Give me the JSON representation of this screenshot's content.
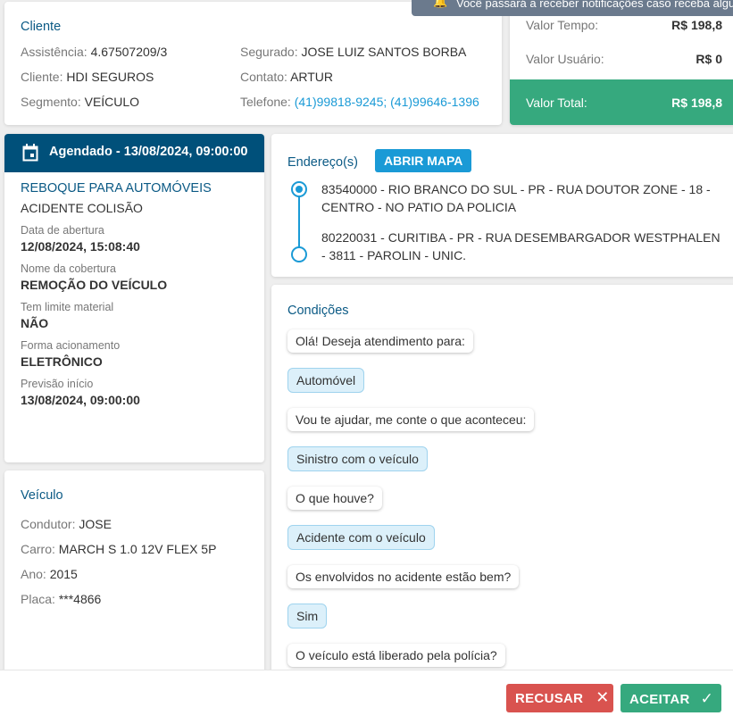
{
  "toast": {
    "text": "Você passará a receber notificações caso receba algu",
    "icon": "bell-icon"
  },
  "cliente": {
    "title": "Cliente",
    "assistencia_label": "Assistência:",
    "assistencia": "4.67507209/3",
    "cliente_label": "Cliente:",
    "cliente": "HDI SEGUROS",
    "segmento_label": "Segmento:",
    "segmento": "VEÍCULO",
    "segurado_label": "Segurado:",
    "segurado": "JOSE LUIZ SANTOS BORBA",
    "contato_label": "Contato:",
    "contato": "ARTUR",
    "telefone_label": "Telefone:",
    "telefone": "(41)99818-9245; (41)99646-1396"
  },
  "valores": {
    "tempo_label": "Valor Tempo:",
    "tempo": "R$ 198,8",
    "usuario_label": "Valor Usuário:",
    "usuario": "R$ 0",
    "total_label": "Valor Total:",
    "total": "R$ 198,8",
    "total_color": "#36a97e"
  },
  "agendado": {
    "header": "Agendado - 13/08/2024, 09:00:00",
    "header_color": "#00507a",
    "servico": "REBOQUE PARA AUTOMÓVEIS",
    "motivo": "ACIDENTE COLISÃO",
    "fields": [
      {
        "label": "Data de abertura",
        "value": "12/08/2024, 15:08:40"
      },
      {
        "label": "Nome da cobertura",
        "value": "REMOÇÃO DO VEÍCULO"
      },
      {
        "label": "Tem limite material",
        "value": "NÃO"
      },
      {
        "label": "Forma acionamento",
        "value": "ELETRÔNICO"
      },
      {
        "label": "Previsão início",
        "value": "13/08/2024, 09:00:00"
      }
    ]
  },
  "veiculo": {
    "title": "Veículo",
    "condutor_label": "Condutor:",
    "condutor": "JOSE",
    "carro_label": "Carro:",
    "carro": "MARCH S 1.0 12V FLEX 5P",
    "ano_label": "Ano:",
    "ano": "2015",
    "placa_label": "Placa:",
    "placa": "***4866"
  },
  "enderecos": {
    "title": "Endereço(s)",
    "map_button": "ABRIR MAPA",
    "items": [
      "83540000 - RIO BRANCO DO SUL - PR - RUA DOUTOR ZONE - 18 - CENTRO - NO PATIO DA POLICIA",
      "80220031 - CURITIBA - PR - RUA DESEMBARGADOR WESTPHALEN - 3811 - PAROLIN - UNIC."
    ]
  },
  "condicoes": {
    "title": "Condições",
    "messages": [
      {
        "text": "Olá! Deseja atendimento para:",
        "from": "bot"
      },
      {
        "text": "Automóvel",
        "from": "user"
      },
      {
        "text": "Vou te ajudar, me conte o que aconteceu:",
        "from": "bot"
      },
      {
        "text": "Sinistro com o veículo",
        "from": "user"
      },
      {
        "text": "O que houve?",
        "from": "bot"
      },
      {
        "text": "Acidente com o veículo",
        "from": "user"
      },
      {
        "text": "Os envolvidos no acidente estão bem?",
        "from": "bot"
      },
      {
        "text": "Sim",
        "from": "user"
      },
      {
        "text": "O veículo está liberado pela polícia?",
        "from": "bot"
      }
    ]
  },
  "footer": {
    "recusar": "RECUSAR",
    "aceitar": "ACEITAR",
    "recusar_color": "#d9534f",
    "aceitar_color": "#36a97e"
  }
}
